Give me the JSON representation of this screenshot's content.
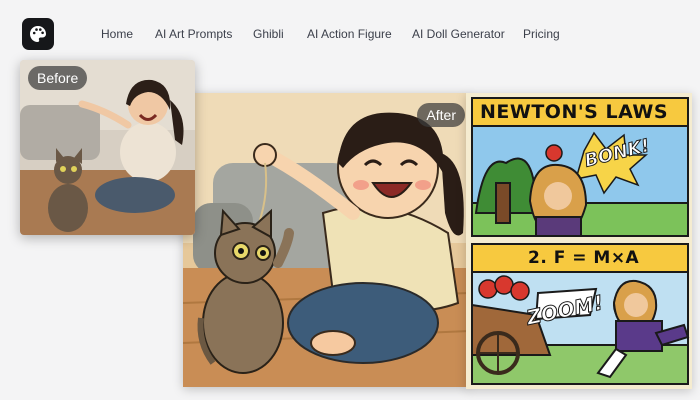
{
  "nav": {
    "logo_icon": "palette-icon",
    "items": [
      "Home",
      "AI Art Prompts",
      "Ghibli",
      "AI Action Figure",
      "AI Doll Generator",
      "Pricing"
    ]
  },
  "gallery": {
    "before_label": "Before",
    "after_label": "After",
    "comic": {
      "title": "NEWTON'S LAWS",
      "subtitle": "2. F = M×A",
      "sfx_top": "BONK!",
      "sfx_bottom": "ZOOM!"
    }
  },
  "colors": {
    "accent_dark": "#16171a",
    "nav_text": "#3b3f4a",
    "comic_yellow": "#f7c93f",
    "page_bg": "#f4f4f5"
  }
}
